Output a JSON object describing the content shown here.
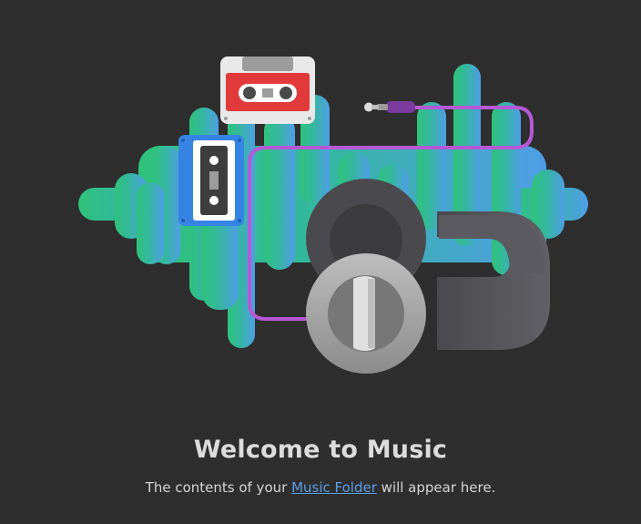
{
  "empty_state": {
    "title": "Welcome to Music",
    "message_prefix": "The contents of your ",
    "link_text": "Music Folder",
    "message_suffix": " will appear here."
  },
  "illustration": {
    "name": "music-illustration",
    "elements": [
      "sound-wave",
      "red-cassette-icon",
      "blue-cassette-icon",
      "headphones-icon",
      "audio-cable"
    ]
  },
  "colors": {
    "background": "#2e2e2e",
    "wave_start": "#2fc27a",
    "wave_end": "#4f9ee6",
    "cable": "#b659d6",
    "link": "#5b9ee8",
    "title_text": "#dcdcdc"
  }
}
